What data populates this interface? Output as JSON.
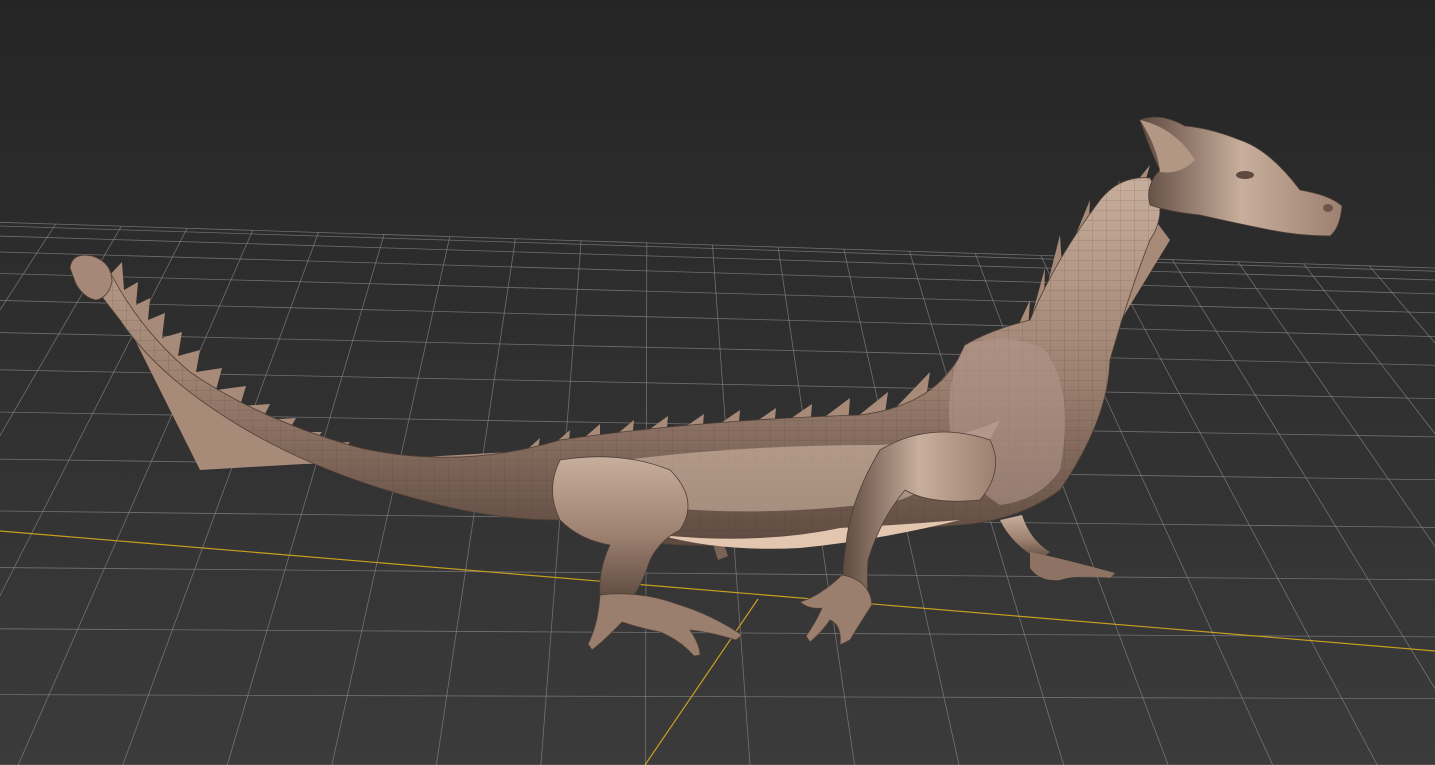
{
  "viewport": {
    "name": "perspective-viewport",
    "background_top": "#252525",
    "background_bottom": "#3b3b3b",
    "grid_color": "#8a8a8a",
    "axis_color": "#c8a020"
  },
  "model": {
    "name": "dragon-sculpt",
    "skin_light": "#c8ae9c",
    "skin_mid": "#9c8070",
    "skin_dark": "#5e4a40",
    "belly_color": "#e2c6b0",
    "wireframe_color": "#4a3a32"
  }
}
